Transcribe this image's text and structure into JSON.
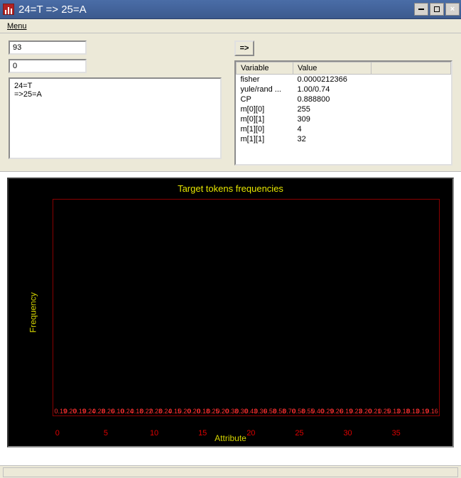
{
  "window": {
    "title": "24=T => 25=A",
    "menu": {
      "items": [
        "Menu"
      ]
    },
    "buttons": {
      "min": "_",
      "max": "□",
      "close": "×"
    }
  },
  "inputs": {
    "field1": "93",
    "field2": "0",
    "compute_label": "=>"
  },
  "multiline": "24=T\n=>25=A",
  "table": {
    "headers": [
      "Variable",
      "Value"
    ],
    "rows": [
      [
        "fisher",
        "0.0000212366"
      ],
      [
        "yule/rand ...",
        "1.00/0.74"
      ],
      [
        "CP",
        "0.888800"
      ],
      [
        "m[0][0]",
        "255"
      ],
      [
        "m[0][1]",
        "309"
      ],
      [
        "m[1][0]",
        "4"
      ],
      [
        "m[1][1]",
        "32"
      ]
    ]
  },
  "chart_data": {
    "type": "bar",
    "title": "Target tokens frequencies",
    "xlabel": "Attribute",
    "ylabel": "Frequency",
    "xlim": [
      0,
      39
    ],
    "ylim": [
      0,
      0.8
    ],
    "xticks": [
      0,
      5,
      10,
      15,
      20,
      25,
      30,
      35
    ],
    "categories": [
      0,
      1,
      2,
      3,
      4,
      5,
      6,
      7,
      8,
      9,
      10,
      11,
      12,
      13,
      14,
      15,
      16,
      17,
      18,
      19,
      20,
      21,
      22,
      23,
      24,
      25,
      26,
      27,
      28,
      29,
      30,
      31,
      32,
      33,
      34,
      35,
      36,
      37,
      38,
      39
    ],
    "values": [
      0.19,
      0.2,
      0.19,
      0.24,
      0.28,
      0.26,
      0.1,
      0.24,
      0.18,
      0.22,
      0.28,
      0.24,
      0.15,
      0.2,
      0.2,
      0.18,
      0.25,
      0.2,
      0.38,
      0.3,
      0.43,
      0.36,
      0.58,
      0.58,
      0.7,
      0.58,
      0.55,
      0.4,
      0.29,
      0.26,
      0.19,
      0.23,
      0.2,
      0.21,
      0.25,
      0.13,
      0.18,
      0.13,
      0.19,
      0.16
    ]
  }
}
